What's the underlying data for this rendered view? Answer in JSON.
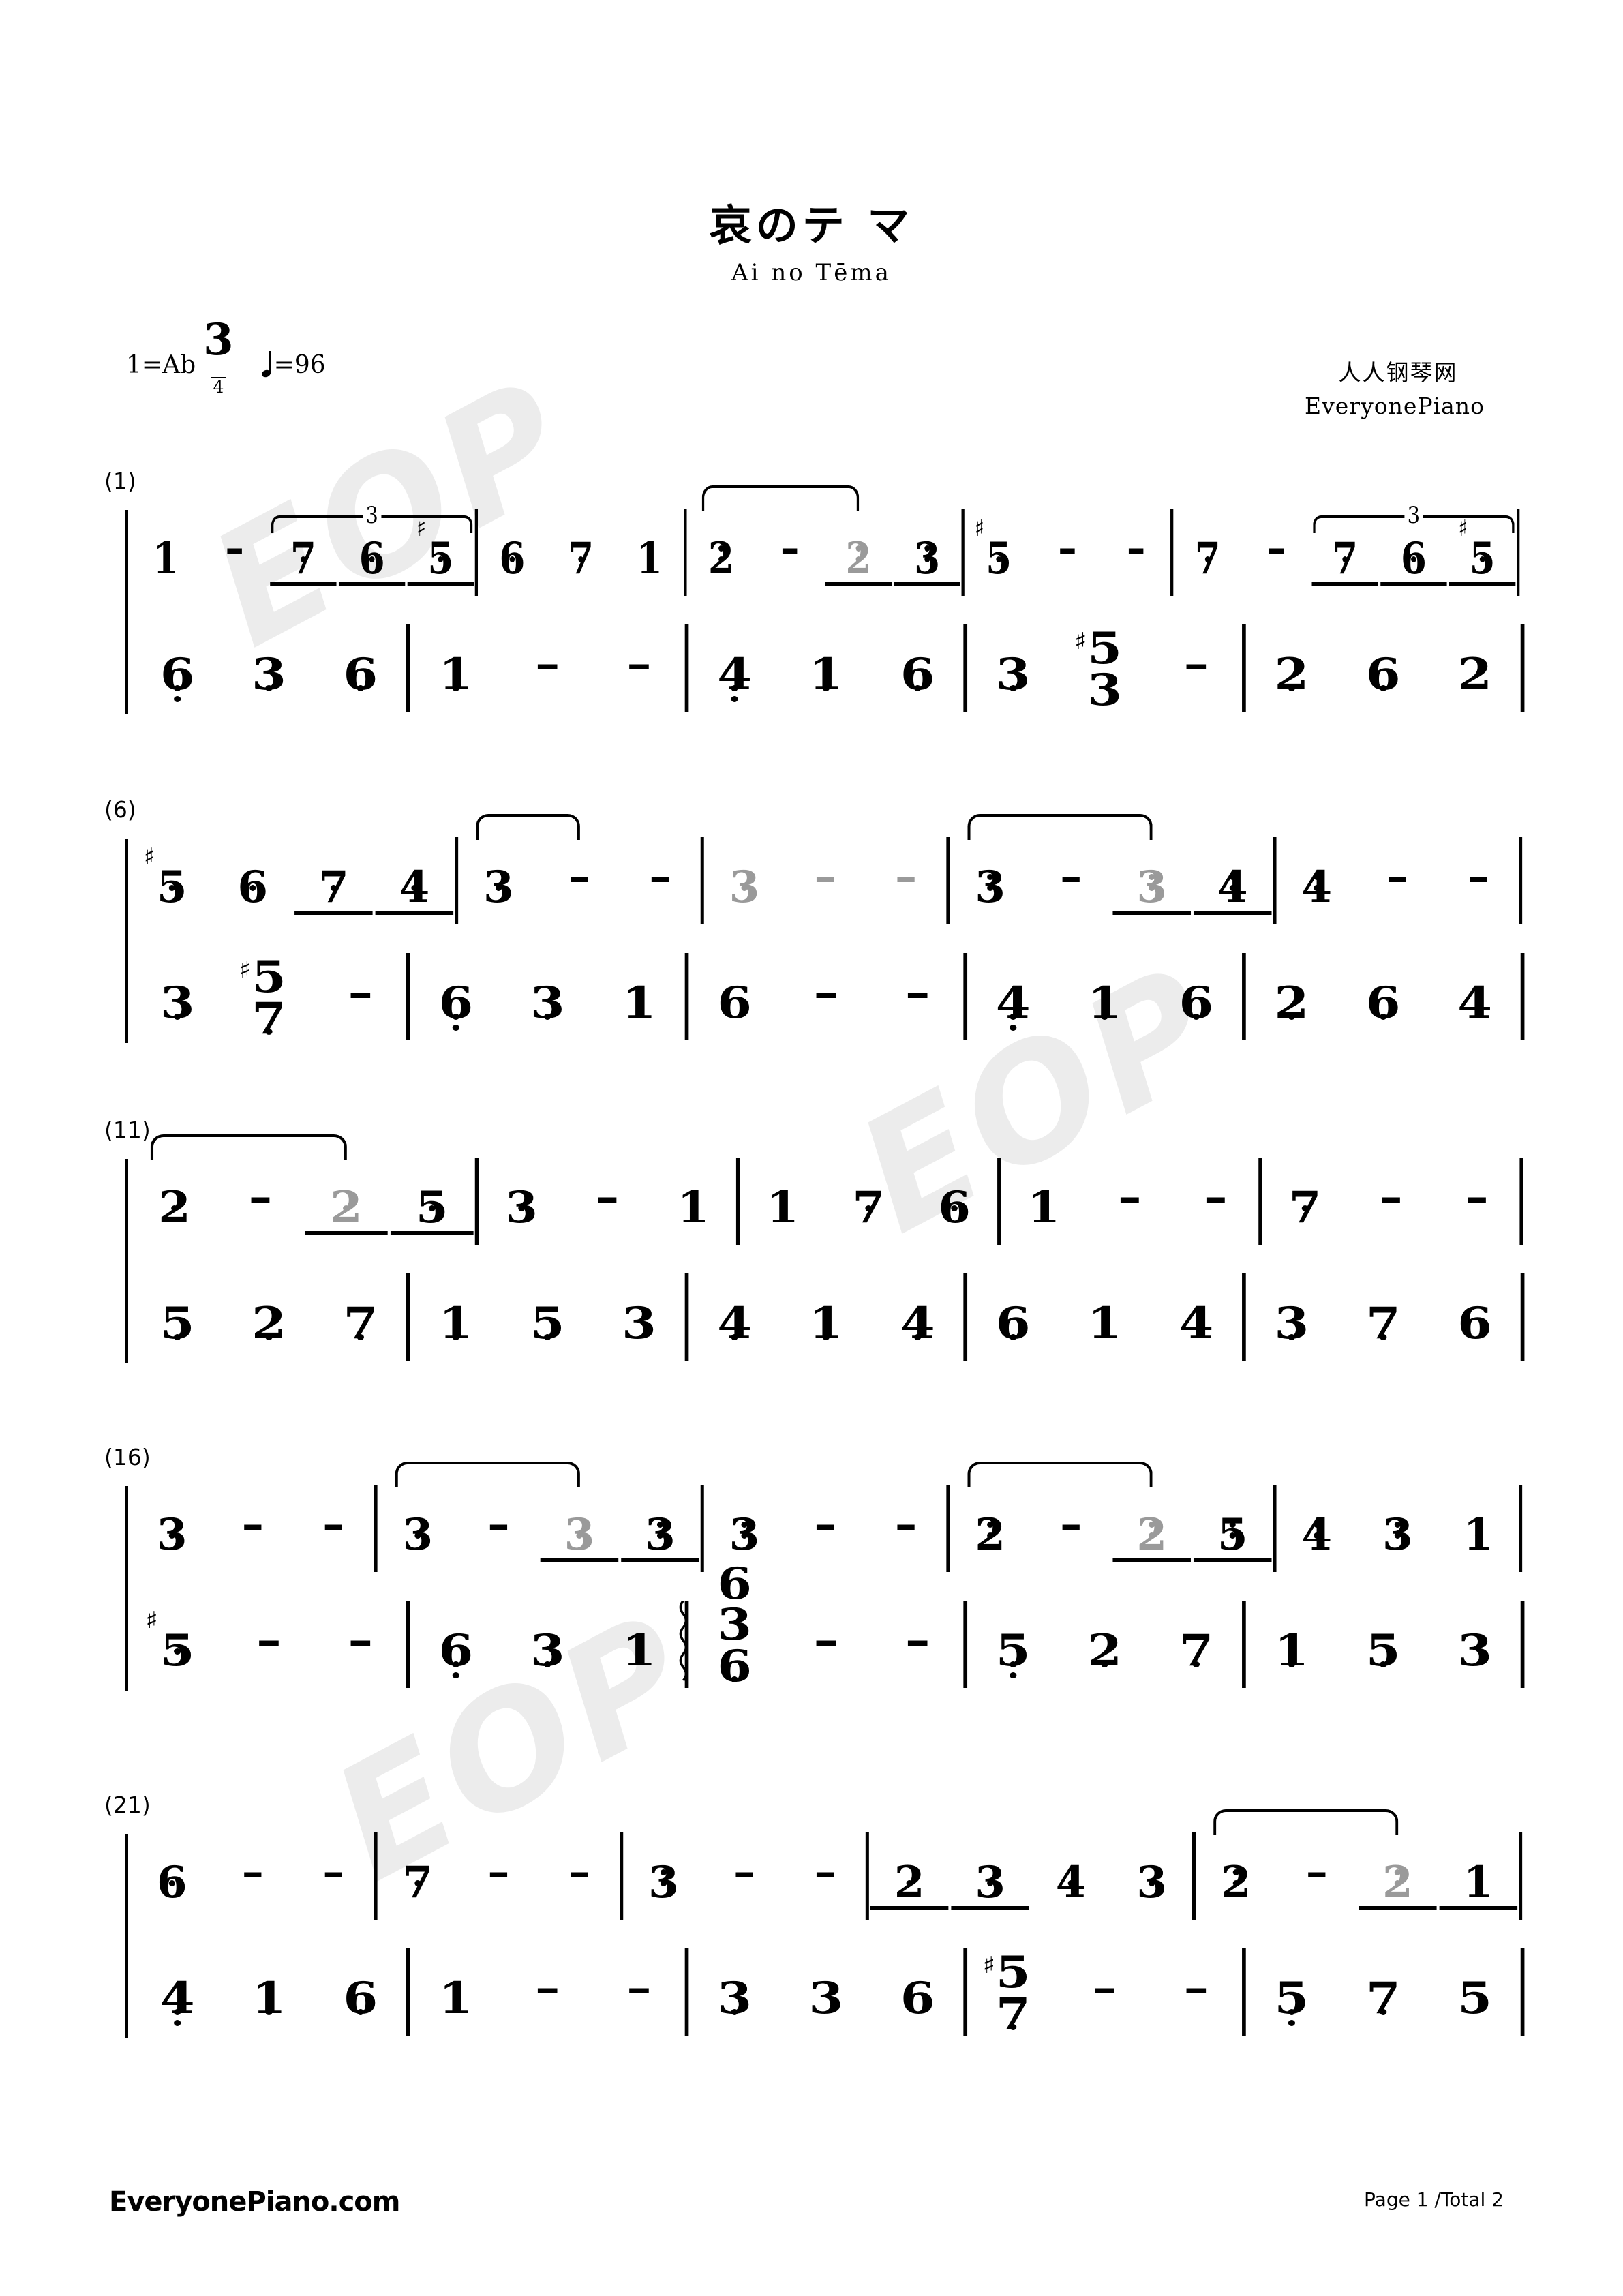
{
  "meta": {
    "title": "哀のテ マ",
    "subtitle": "Ai no Tēma",
    "key_label": "1=Ab",
    "time_num": "3",
    "time_den": "4",
    "tempo_label": "=96",
    "brand_cn": "人人钢琴网",
    "brand_en": "EveryonePiano",
    "footer_left": "EveryonePiano.com",
    "footer_right": "Page 1 /Total 2",
    "watermark_text": "EOP",
    "note_color": "#000000",
    "tied_note_color": "#9a9a9a",
    "watermark_color": "#ececec"
  },
  "systems": [
    {
      "number": "(1)",
      "treble": [
        {
          "notes": [
            {
              "n": "1",
              "oct": 1
            },
            {
              "n": "-"
            },
            {
              "n": "7",
              "oct": 1,
              "beam": true,
              "triplet_start": true
            },
            {
              "n": "6",
              "oct": 1,
              "beam": true
            },
            {
              "n": "5",
              "oct": 1,
              "beam": true,
              "sharp": true,
              "triplet_end": true
            }
          ]
        },
        {
          "notes": [
            {
              "n": "6",
              "oct": 1
            },
            {
              "n": "7",
              "oct": 1
            },
            {
              "n": "1",
              "oct": 2
            }
          ]
        },
        {
          "notes": [
            {
              "n": "2",
              "oct": 2,
              "tie_start": true
            },
            {
              "n": "-"
            },
            {
              "n": "2",
              "oct": 2,
              "grey": true,
              "beam": true
            },
            {
              "n": "3",
              "oct": 2,
              "beam": true
            }
          ]
        },
        {
          "notes": [
            {
              "n": "5",
              "oct": 1,
              "sharp": true
            },
            {
              "n": "-"
            },
            {
              "n": "-"
            }
          ]
        },
        {
          "notes": [
            {
              "n": "7",
              "oct": 1
            },
            {
              "n": "-"
            },
            {
              "n": "7",
              "oct": 1,
              "beam": true,
              "triplet_start": true
            },
            {
              "n": "6",
              "oct": 1,
              "beam": true
            },
            {
              "n": "5",
              "oct": 1,
              "beam": true,
              "sharp": true,
              "triplet_end": true
            }
          ]
        }
      ],
      "bass": [
        {
          "notes": [
            {
              "n": "6",
              "oct": -2
            },
            {
              "n": "3",
              "oct": -1
            },
            {
              "n": "6",
              "oct": -1
            }
          ]
        },
        {
          "notes": [
            {
              "n": "1",
              "oct": -1
            },
            {
              "n": "-"
            },
            {
              "n": "-"
            }
          ]
        },
        {
          "notes": [
            {
              "n": "4",
              "oct": -2
            },
            {
              "n": "1",
              "oct": -1
            },
            {
              "n": "6",
              "oct": -1
            }
          ]
        },
        {
          "notes": [
            {
              "n": "3",
              "oct": -1
            },
            {
              "chord": [
                "5",
                "3"
              ],
              "chord_sharp_top": true
            },
            {
              "n": "-"
            }
          ]
        },
        {
          "notes": [
            {
              "n": "2",
              "oct": -1
            },
            {
              "n": "6",
              "oct": -1
            },
            {
              "n": "2"
            }
          ]
        }
      ]
    },
    {
      "number": "(6)",
      "treble": [
        {
          "notes": [
            {
              "n": "5",
              "oct": 1,
              "sharp": true
            },
            {
              "n": "6",
              "oct": 1
            },
            {
              "n": "7",
              "oct": 1,
              "beam": true
            },
            {
              "n": "4",
              "oct": 1,
              "beam": true
            }
          ]
        },
        {
          "notes": [
            {
              "n": "3",
              "oct": 1,
              "tie_start": true
            },
            {
              "n": "-"
            },
            {
              "n": "-"
            }
          ]
        },
        {
          "notes": [
            {
              "n": "3",
              "oct": 1,
              "grey": true
            },
            {
              "n": "-",
              "grey": true
            },
            {
              "n": "-",
              "grey": true
            }
          ]
        },
        {
          "notes": [
            {
              "n": "3",
              "oct": 2,
              "tie_start": true
            },
            {
              "n": "-"
            },
            {
              "n": "3",
              "oct": 2,
              "grey": true,
              "beam": true
            },
            {
              "n": "4",
              "oct": 2,
              "beam": true
            }
          ]
        },
        {
          "notes": [
            {
              "n": "4",
              "oct": 2
            },
            {
              "n": "-"
            },
            {
              "n": "-"
            }
          ]
        }
      ],
      "bass": [
        {
          "notes": [
            {
              "n": "3",
              "oct": -1
            },
            {
              "chord": [
                "5",
                "7"
              ],
              "chord_sharp_top": true,
              "oct": -1
            },
            {
              "n": "-"
            }
          ]
        },
        {
          "notes": [
            {
              "n": "6",
              "oct": -2
            },
            {
              "n": "3",
              "oct": -1
            },
            {
              "n": "1"
            }
          ]
        },
        {
          "notes": [
            {
              "n": "6"
            },
            {
              "n": "-"
            },
            {
              "n": "-"
            }
          ]
        },
        {
          "notes": [
            {
              "n": "4",
              "oct": -2
            },
            {
              "n": "1",
              "oct": -1
            },
            {
              "n": "6",
              "oct": -1
            }
          ]
        },
        {
          "notes": [
            {
              "n": "2",
              "oct": -1
            },
            {
              "n": "6",
              "oct": -1
            },
            {
              "n": "4"
            }
          ]
        }
      ]
    },
    {
      "number": "(11)",
      "treble": [
        {
          "notes": [
            {
              "n": "2",
              "oct": 1,
              "tie_start": true
            },
            {
              "n": "-"
            },
            {
              "n": "2",
              "oct": 1,
              "grey": true,
              "beam": true
            },
            {
              "n": "5",
              "oct": 1,
              "beam": true
            }
          ]
        },
        {
          "notes": [
            {
              "n": "3",
              "oct": 1
            },
            {
              "n": "-"
            },
            {
              "n": "1",
              "oct": 2
            }
          ]
        },
        {
          "notes": [
            {
              "n": "1",
              "oct": 2
            },
            {
              "n": "7",
              "oct": 1
            },
            {
              "n": "6",
              "oct": 1
            }
          ]
        },
        {
          "notes": [
            {
              "n": "1",
              "oct": 2
            },
            {
              "n": "-"
            },
            {
              "n": "-"
            }
          ]
        },
        {
          "notes": [
            {
              "n": "7",
              "oct": 1
            },
            {
              "n": "-"
            },
            {
              "n": "-"
            }
          ]
        }
      ],
      "bass": [
        {
          "notes": [
            {
              "n": "5",
              "oct": -1
            },
            {
              "n": "2",
              "oct": -1
            },
            {
              "n": "7",
              "oct": -1
            }
          ]
        },
        {
          "notes": [
            {
              "n": "1",
              "oct": -1
            },
            {
              "n": "5",
              "oct": -1
            },
            {
              "n": "3"
            }
          ]
        },
        {
          "notes": [
            {
              "n": "4",
              "oct": -1
            },
            {
              "n": "1",
              "oct": -1
            },
            {
              "n": "4",
              "oct": -1
            }
          ]
        },
        {
          "notes": [
            {
              "n": "6",
              "oct": -1
            },
            {
              "n": "1"
            },
            {
              "n": "4"
            }
          ]
        },
        {
          "notes": [
            {
              "n": "3",
              "oct": -1
            },
            {
              "n": "7",
              "oct": -1
            },
            {
              "n": "6"
            }
          ]
        }
      ]
    },
    {
      "number": "(16)",
      "treble": [
        {
          "notes": [
            {
              "n": "3",
              "oct": 1
            },
            {
              "n": "-"
            },
            {
              "n": "-"
            }
          ]
        },
        {
          "notes": [
            {
              "n": "3",
              "oct": 1,
              "tie_start": true
            },
            {
              "n": "-"
            },
            {
              "n": "3",
              "oct": 1,
              "grey": true,
              "beam": true
            },
            {
              "n": "3",
              "oct": 2,
              "beam": true
            }
          ]
        },
        {
          "notes": [
            {
              "n": "3",
              "oct": 2
            },
            {
              "n": "-"
            },
            {
              "n": "-"
            }
          ]
        },
        {
          "notes": [
            {
              "n": "2",
              "oct": 2,
              "tie_start": true
            },
            {
              "n": "-"
            },
            {
              "n": "2",
              "oct": 2,
              "grey": true,
              "beam": true
            },
            {
              "n": "5",
              "oct": 2,
              "beam": true
            }
          ]
        },
        {
          "notes": [
            {
              "n": "4",
              "oct": 2
            },
            {
              "n": "3",
              "oct": 2
            },
            {
              "n": "1",
              "oct": 2
            }
          ]
        }
      ],
      "bass": [
        {
          "notes": [
            {
              "n": "5",
              "oct": 1,
              "sharp": true
            },
            {
              "n": "-"
            },
            {
              "n": "-"
            }
          ]
        },
        {
          "notes": [
            {
              "n": "6",
              "oct": -2
            },
            {
              "n": "3",
              "oct": -1
            },
            {
              "n": "1"
            }
          ]
        },
        {
          "notes": [
            {
              "chord": [
                "6",
                "3",
                "6"
              ],
              "arp": true,
              "oct": -1
            },
            {
              "n": "-"
            },
            {
              "n": "-"
            }
          ]
        },
        {
          "notes": [
            {
              "n": "5",
              "oct": -2
            },
            {
              "n": "2",
              "oct": -1
            },
            {
              "n": "7",
              "oct": -1
            }
          ]
        },
        {
          "notes": [
            {
              "n": "1",
              "oct": -1
            },
            {
              "n": "5",
              "oct": -1
            },
            {
              "n": "3"
            }
          ]
        }
      ]
    },
    {
      "number": "(21)",
      "treble": [
        {
          "notes": [
            {
              "n": "6",
              "oct": 1
            },
            {
              "n": "-"
            },
            {
              "n": "-"
            }
          ]
        },
        {
          "notes": [
            {
              "n": "7",
              "oct": 1
            },
            {
              "n": "-"
            },
            {
              "n": "-"
            }
          ]
        },
        {
          "notes": [
            {
              "n": "3",
              "oct": 2
            },
            {
              "n": "-"
            },
            {
              "n": "-"
            }
          ]
        },
        {
          "notes": [
            {
              "n": "2",
              "oct": 1,
              "beam": true
            },
            {
              "n": "3",
              "oct": 1,
              "beam": true
            },
            {
              "n": "4",
              "oct": 1
            },
            {
              "n": "3",
              "oct": 1
            }
          ]
        },
        {
          "notes": [
            {
              "n": "2",
              "oct": 2,
              "tie_start": true
            },
            {
              "n": "-"
            },
            {
              "n": "2",
              "oct": 2,
              "grey": true,
              "beam": true
            },
            {
              "n": "1",
              "oct": 2,
              "beam": true
            }
          ]
        }
      ],
      "bass": [
        {
          "notes": [
            {
              "n": "4",
              "oct": -2
            },
            {
              "n": "1",
              "oct": -1
            },
            {
              "n": "6",
              "oct": -1
            }
          ]
        },
        {
          "notes": [
            {
              "n": "1"
            },
            {
              "n": "-"
            },
            {
              "n": "-"
            }
          ]
        },
        {
          "notes": [
            {
              "n": "3",
              "oct": -1
            },
            {
              "n": "3"
            },
            {
              "n": "6"
            }
          ]
        },
        {
          "notes": [
            {
              "chord": [
                "5",
                "7"
              ],
              "chord_sharp_top": true,
              "oct": -1
            },
            {
              "n": "-"
            },
            {
              "n": "-"
            }
          ]
        },
        {
          "notes": [
            {
              "n": "5",
              "oct": -2
            },
            {
              "n": "7",
              "oct": -1
            },
            {
              "n": "5"
            }
          ]
        }
      ]
    }
  ]
}
